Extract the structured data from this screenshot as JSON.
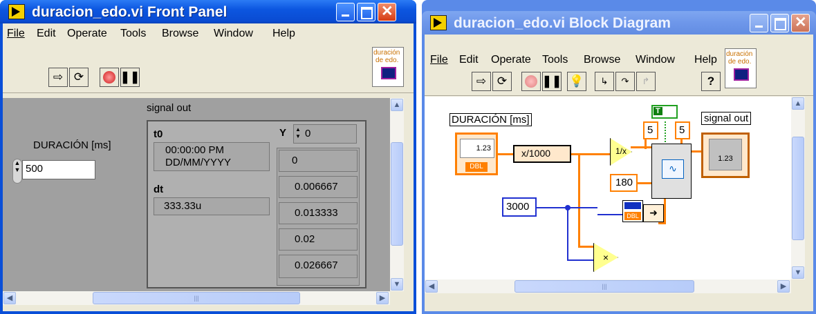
{
  "front": {
    "title": "duracion_edo.vi Front Panel",
    "menu": [
      "File",
      "Edit",
      "Operate",
      "Tools",
      "Browse",
      "Window",
      "Help"
    ],
    "icon_text": [
      "duración",
      "de edo."
    ],
    "duration_label": "DURACIÓN [ms]",
    "duration_value": "500",
    "signal_label": "signal out",
    "t0_label": "t0",
    "t0_time": "00:00:00 PM",
    "t0_date": "DD/MM/YYYY",
    "dt_label": "dt",
    "dt_value": "333.33u",
    "y_label": "Y",
    "y_index": "0",
    "y_values": [
      "0",
      "0.006667",
      "0.013333",
      "0.02",
      "0.026667"
    ],
    "scroll_grip": "|||"
  },
  "block": {
    "title": "duracion_edo.vi Block Diagram",
    "menu": [
      "File",
      "Edit",
      "Operate",
      "Tools",
      "Browse",
      "Window",
      "Help"
    ],
    "icon_text": [
      "duración",
      "de edo."
    ],
    "duration_label": "DURACIÓN [ms]",
    "control_text": "1.23",
    "dbl_tag": "DBL",
    "divide_expr": "x/1000",
    "const_a": "5",
    "const_b": "5",
    "const_180": "180",
    "const_3000": "3000",
    "bool_const": "T",
    "signal_label": "signal out",
    "graph_text": "1.23",
    "scroll_grip": "|||"
  },
  "colors": {
    "title_blue": "#0a4fd8",
    "orange_wire": "#ff8000",
    "blue_wire": "#2030d0",
    "window_bg": "#ece9d8",
    "panel_gray": "#a0a0a0"
  }
}
